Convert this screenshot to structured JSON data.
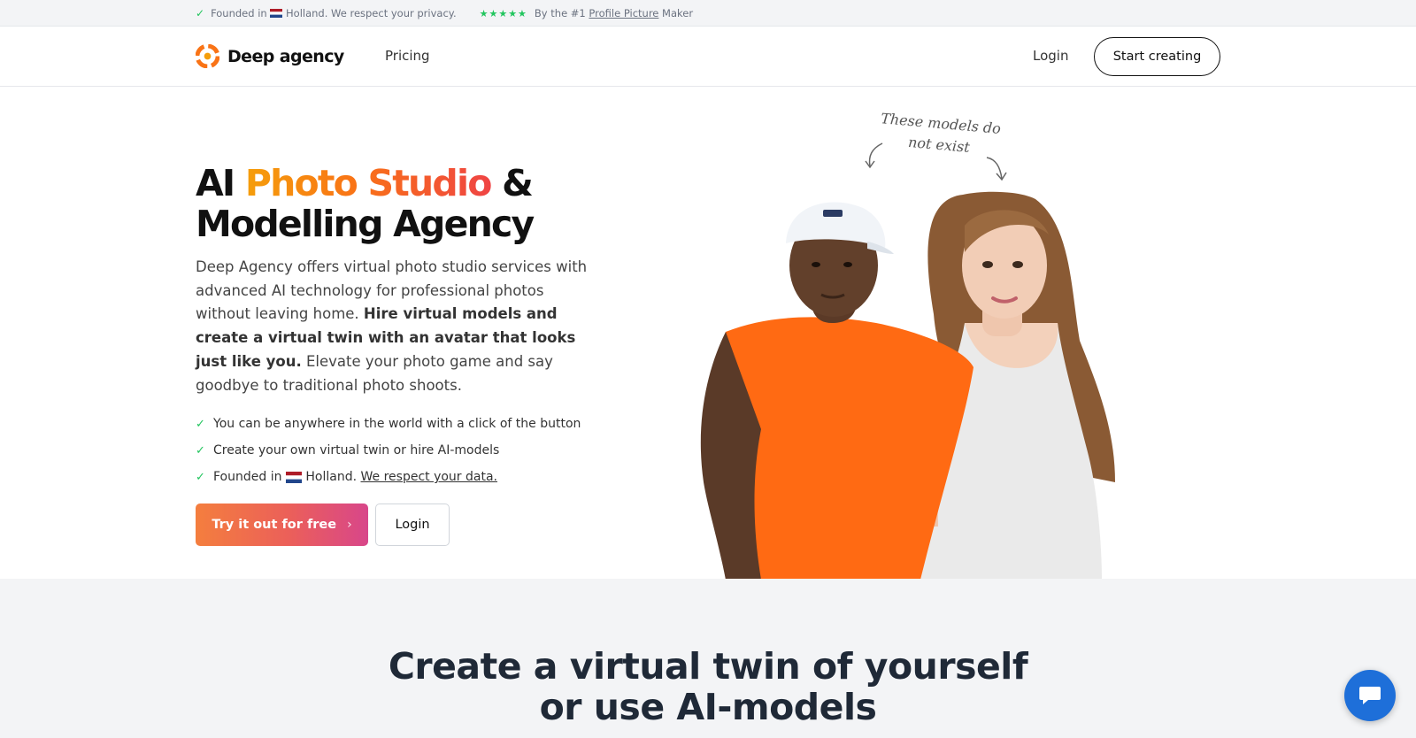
{
  "topbar": {
    "founded_prefix": "Founded in",
    "founded_suffix": "Holland. We respect your privacy.",
    "stars": "★★★★★",
    "rating_prefix": "By the #1",
    "rating_link": "Profile Picture",
    "rating_suffix": "Maker"
  },
  "nav": {
    "logo_text": "Deep agency",
    "pricing": "Pricing",
    "login": "Login",
    "start_creating": "Start creating"
  },
  "hero": {
    "title_plain_1": "AI",
    "title_gradient": "Photo Studio",
    "title_plain_2": "&",
    "title_line2": "Modelling Agency",
    "desc_1": "Deep Agency offers virtual photo studio services with advanced AI technology for professional photos without leaving home.",
    "desc_bold": "Hire virtual models and create a virtual twin with an avatar that looks just like you.",
    "desc_2": "Elevate your photo game and say goodbye to traditional photo shoots.",
    "bullets": [
      "You can be anywhere in the world with a click of the button",
      "Create your own virtual twin or hire AI-models"
    ],
    "bullet3_prefix": "Founded in",
    "bullet3_middle": "Holland.",
    "bullet3_link": "We respect your data.",
    "cta_primary": "Try it out for free",
    "cta_secondary": "Login"
  },
  "illustration": {
    "note_line1": "These models do",
    "note_line2": "not exist"
  },
  "section2": {
    "title_line1": "Create a virtual twin of yourself",
    "title_line2": "or use AI-models"
  },
  "colors": {
    "accent_green": "#22c55e",
    "cta_gradient_start": "#f47e3e",
    "cta_gradient_end": "#d8468a",
    "chat_blue": "#1e6fd9",
    "shirt_orange": "#ff6a13"
  },
  "icons": [
    "check-icon",
    "star-icon",
    "netherlands-flag-icon",
    "logo-icon",
    "chevron-right-icon",
    "chat-icon",
    "arrow-icon"
  ]
}
